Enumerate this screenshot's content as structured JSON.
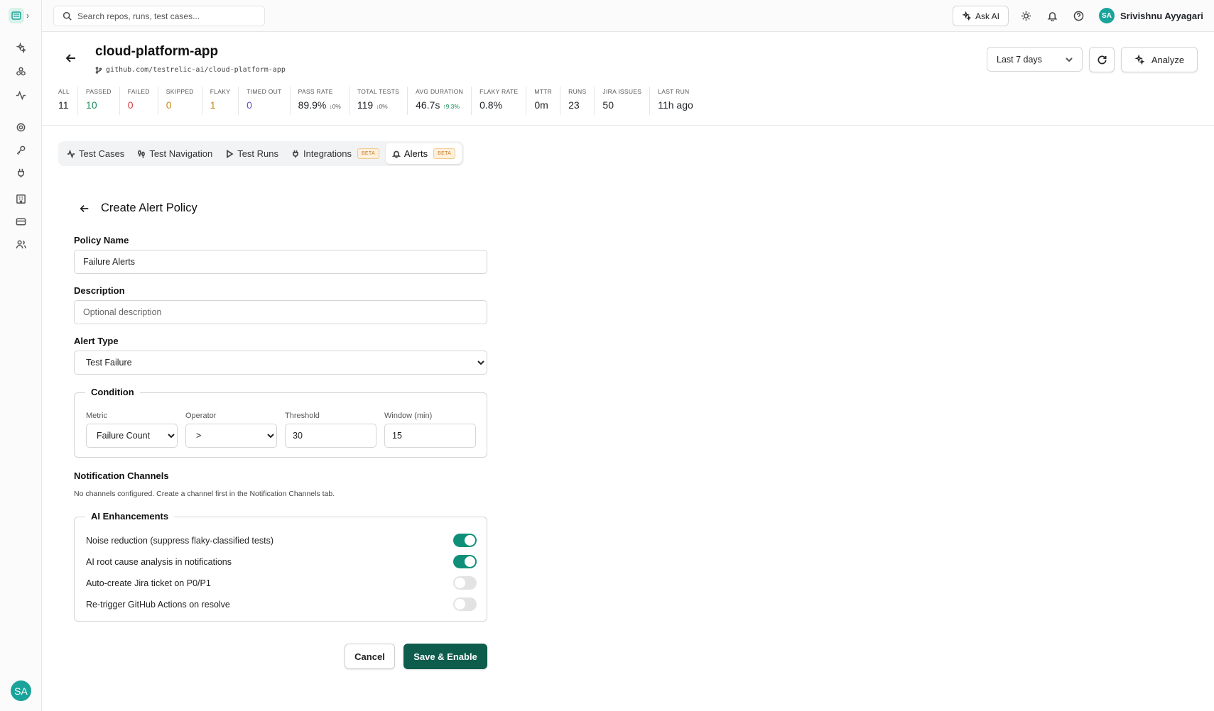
{
  "search": {
    "placeholder": "Search repos, runs, test cases..."
  },
  "topbar": {
    "ask_ai": "Ask AI",
    "user_initials": "SA",
    "user_name": "Srivishnu Ayyagari"
  },
  "repo": {
    "title": "cloud-platform-app",
    "url": "github.com/testrelic-ai/cloud-platform-app"
  },
  "controls": {
    "range": "Last 7 days",
    "analyze": "Analyze"
  },
  "stats": [
    {
      "label": "ALL",
      "value": "11",
      "delta": "",
      "color": "#1f2328"
    },
    {
      "label": "PASSED",
      "value": "10",
      "delta": "",
      "color": "#1a8f5a"
    },
    {
      "label": "FAILED",
      "value": "0",
      "delta": "",
      "color": "#d43c3c"
    },
    {
      "label": "SKIPPED",
      "value": "0",
      "delta": "",
      "color": "#c98a14"
    },
    {
      "label": "FLAKY",
      "value": "1",
      "delta": "",
      "color": "#c98a14"
    },
    {
      "label": "TIMED OUT",
      "value": "0",
      "delta": "",
      "color": "#6a4bd1"
    },
    {
      "label": "PASS RATE",
      "value": "89.9%",
      "delta": "↓0%",
      "color": "#1f2328"
    },
    {
      "label": "TOTAL TESTS",
      "value": "119",
      "delta": "↓0%",
      "color": "#1f2328"
    },
    {
      "label": "AVG DURATION",
      "value": "46.7s",
      "delta": "↑9.3%",
      "color": "#1f2328"
    },
    {
      "label": "FLAKY RATE",
      "value": "0.8%",
      "delta": "",
      "color": "#1f2328"
    },
    {
      "label": "MTTR",
      "value": "0m",
      "delta": "",
      "color": "#1f2328"
    },
    {
      "label": "RUNS",
      "value": "23",
      "delta": "",
      "color": "#1f2328"
    },
    {
      "label": "JIRA ISSUES",
      "value": "50",
      "delta": "",
      "color": "#1f2328"
    },
    {
      "label": "LAST RUN",
      "value": "11h ago",
      "delta": "",
      "color": "#1f2328"
    }
  ],
  "tabs": [
    {
      "label": "Test Cases",
      "beta": ""
    },
    {
      "label": "Test Navigation",
      "beta": ""
    },
    {
      "label": "Test Runs",
      "beta": ""
    },
    {
      "label": "Integrations",
      "beta": "BETA"
    },
    {
      "label": "Alerts",
      "beta": "BETA"
    }
  ],
  "form": {
    "title": "Create Alert Policy",
    "policy_name_label": "Policy Name",
    "policy_name_value": "Failure Alerts",
    "description_label": "Description",
    "description_placeholder": "Optional description",
    "alert_type_label": "Alert Type",
    "alert_type_value": "Test Failure",
    "condition": {
      "legend": "Condition",
      "metric_label": "Metric",
      "metric_value": "Failure Count",
      "operator_label": "Operator",
      "operator_value": ">",
      "threshold_label": "Threshold",
      "threshold_value": "30",
      "window_label": "Window (min)",
      "window_value": "15"
    },
    "notification_title": "Notification Channels",
    "notification_note": "No channels configured. Create a channel first in the Notification Channels tab.",
    "ai": {
      "legend": "AI Enhancements",
      "toggles": [
        {
          "label": "Noise reduction (suppress flaky-classified tests)",
          "on": true
        },
        {
          "label": "AI root cause analysis in notifications",
          "on": true
        },
        {
          "label": "Auto-create Jira ticket on P0/P1",
          "on": false
        },
        {
          "label": "Re-trigger GitHub Actions on resolve",
          "on": false
        }
      ]
    },
    "cancel": "Cancel",
    "save": "Save & Enable"
  },
  "colors": {
    "accent": "#0e5c4c",
    "toggle_on": "#0f8f7a",
    "avatar": "#1aa39a"
  }
}
